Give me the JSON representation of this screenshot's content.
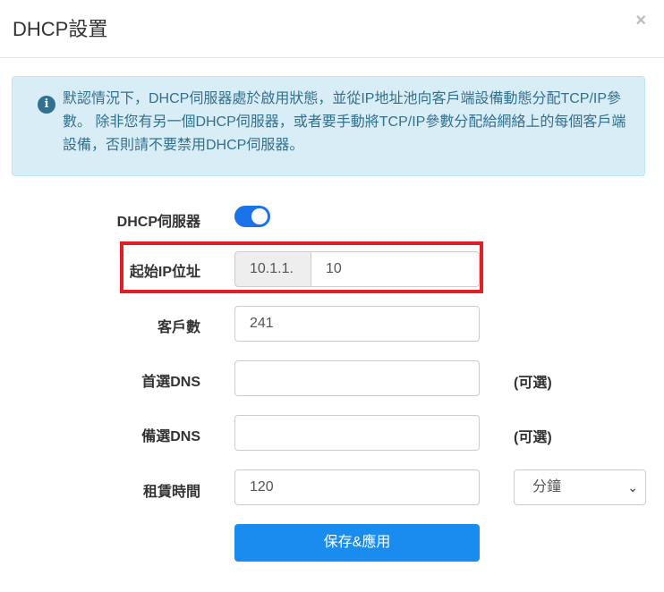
{
  "header": {
    "title": "DHCP設置",
    "close_label": "×"
  },
  "alert": {
    "icon": "info-icon",
    "text": "默認情況下，DHCP伺服器處於啟用狀態，並從IP地址池向客戶端設備動態分配TCP/IP參數。 除非您有另一個DHCP伺服器，或者要手動將TCP/IP參數分配給網絡上的每個客戶端設備，否則請不要禁用DHCP伺服器。"
  },
  "form": {
    "dhcp_server": {
      "label": "DHCP伺服器",
      "enabled": true
    },
    "start_ip": {
      "label": "起始IP位址",
      "prefix": "10.1.1.",
      "value": "10"
    },
    "client_count": {
      "label": "客戶數",
      "value": "241"
    },
    "primary_dns": {
      "label": "首選DNS",
      "value": "",
      "optional": "(可選)"
    },
    "secondary_dns": {
      "label": "備選DNS",
      "value": "",
      "optional": "(可選)"
    },
    "lease_time": {
      "label": "租賃時間",
      "value": "120",
      "unit": "分鐘"
    },
    "save_button": "保存&應用"
  },
  "colors": {
    "accent": "#1a8cf0",
    "highlight": "#e01f26",
    "alert_bg": "#d9edf7",
    "alert_text": "#31708f"
  }
}
